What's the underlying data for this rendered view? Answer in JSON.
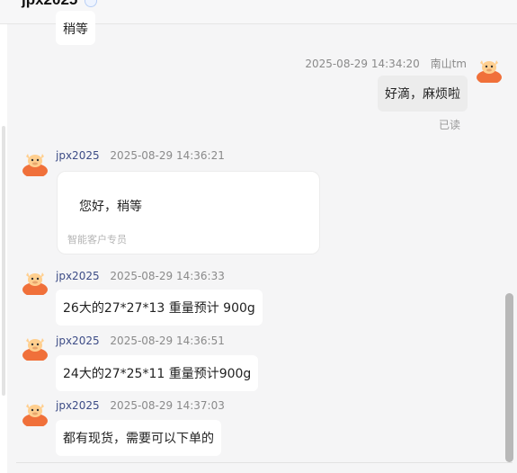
{
  "header": {
    "name": "jpx2025",
    "badge": ""
  },
  "messages": [
    {
      "text": "稍等"
    },
    {
      "time": "2025-08-29 14:34:20",
      "sender": "南山tm",
      "text": "好滴，麻烦啦",
      "status": "已读"
    },
    {
      "sender": "jpx2025",
      "time": "2025-08-29 14:36:21",
      "text": "您好，稍等",
      "tag": "智能客户专员"
    },
    {
      "sender": "jpx2025",
      "time": "2025-08-29 14:36:33",
      "text": "26大的27*27*13  重量预计 900g"
    },
    {
      "sender": "jpx2025",
      "time": "2025-08-29 14:36:51",
      "text": "24大的27*25*11    重量预计900g"
    },
    {
      "sender": "jpx2025",
      "time": "2025-08-29 14:37:03",
      "text": "都有现货，需要可以下单的"
    }
  ],
  "colors": {
    "accent": "#3d4c86",
    "avatar": "#f0703a",
    "avatar_face": "#ffcf8f",
    "badge": "#3a6fd8"
  },
  "icons": {
    "avatar": "cartoon-cow-avatar-icon"
  }
}
